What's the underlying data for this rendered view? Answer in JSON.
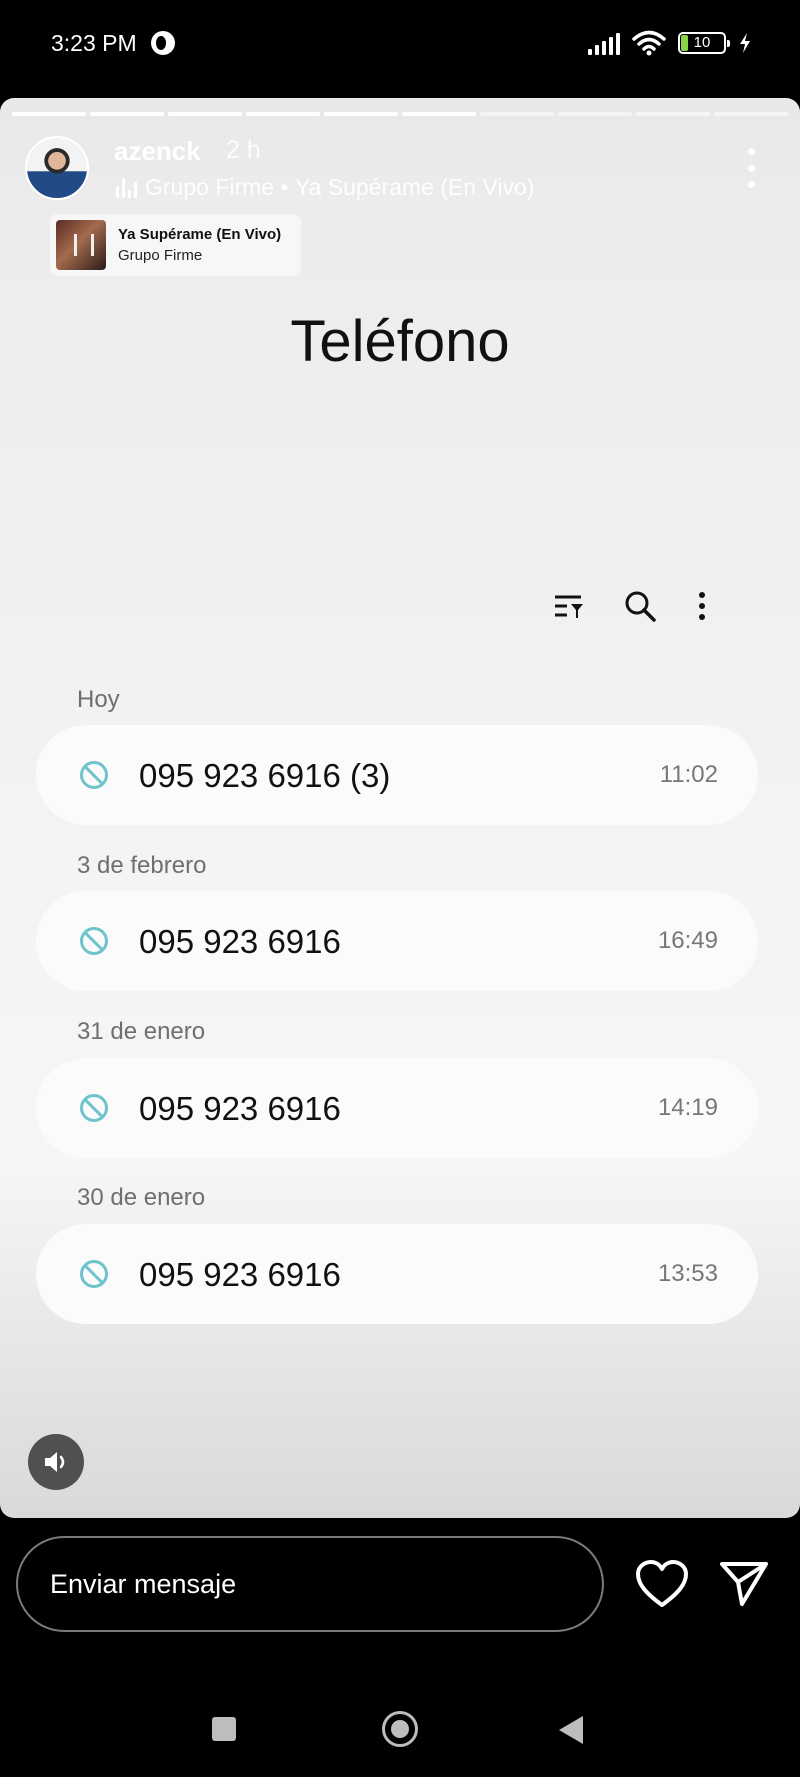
{
  "status_bar": {
    "time": "3:23 PM",
    "battery": "10"
  },
  "story": {
    "username": "azenck",
    "time_ago": "2 h",
    "music_artist": "Grupo Firme",
    "music_separator": " • ",
    "music_song": "Ya Supérame (En Vivo)",
    "sticker": {
      "title": "Ya Supérame (En Vivo)",
      "artist": "Grupo Firme"
    }
  },
  "phone_app": {
    "title": "Teléfono",
    "icons": [
      "filter-icon",
      "search-icon",
      "more-vertical-icon"
    ],
    "groups": [
      {
        "date": "Hoy",
        "number": "095 923 6916 (3)",
        "time": "11:02"
      },
      {
        "date": "3 de febrero",
        "number": "095 923 6916",
        "time": "16:49"
      },
      {
        "date": "31 de enero",
        "number": "095 923 6916",
        "time": "14:19"
      },
      {
        "date": "30 de enero",
        "number": "095 923 6916",
        "time": "13:53"
      }
    ]
  },
  "reply": {
    "placeholder": "Enviar mensaje"
  },
  "colors": {
    "blocked_icon": "#6fc3cc",
    "battery_fill": "#8bd34a"
  }
}
